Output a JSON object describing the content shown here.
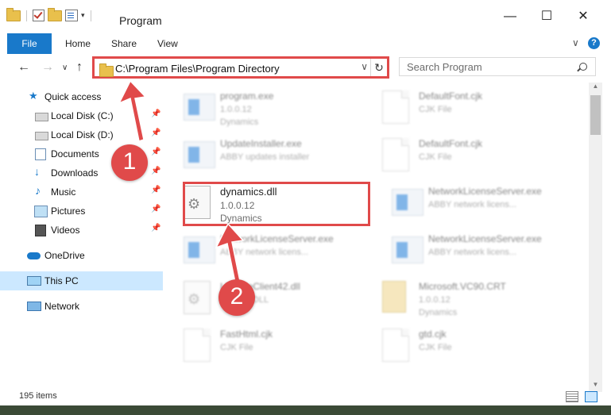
{
  "window": {
    "title": "Program"
  },
  "ribbon": {
    "tabs": [
      "File",
      "Home",
      "Share",
      "View"
    ],
    "help": "?"
  },
  "address": {
    "path": "C:\\Program Files\\Program Directory"
  },
  "search": {
    "placeholder": "Search Program"
  },
  "sidebar": {
    "items": [
      {
        "label": "Quick access",
        "icon": "star-icon",
        "pinned": false
      },
      {
        "label": "Local Disk (C:)",
        "icon": "drive-icon",
        "pinned": true
      },
      {
        "label": "Local Disk (D:)",
        "icon": "drive-icon",
        "pinned": true
      },
      {
        "label": "Documents",
        "icon": "documents-icon",
        "pinned": true
      },
      {
        "label": "Downloads",
        "icon": "download-icon",
        "pinned": true
      },
      {
        "label": "Music",
        "icon": "music-icon",
        "pinned": true
      },
      {
        "label": "Pictures",
        "icon": "pictures-icon",
        "pinned": true
      },
      {
        "label": "Videos",
        "icon": "videos-icon",
        "pinned": true
      },
      {
        "label": "OneDrive",
        "icon": "cloud-icon",
        "pinned": false
      },
      {
        "label": "This PC",
        "icon": "computer-icon",
        "pinned": false,
        "selected": true
      },
      {
        "label": "Network",
        "icon": "network-icon",
        "pinned": false
      }
    ]
  },
  "files": [
    {
      "name": "program.exe",
      "line1": "1.0.0.12",
      "line2": "Dynamics",
      "icon": "app-icon",
      "blurred": true
    },
    {
      "name": "DefaultFont.cjk",
      "line1": "CJK File",
      "line2": "",
      "icon": "document-icon",
      "blurred": true
    },
    {
      "name": "UpdateInstaller.exe",
      "line1": "ABBY updates installer",
      "line2": "",
      "icon": "app-icon",
      "blurred": true
    },
    {
      "name": "DefaultFont.cjk",
      "line1": "CJK File",
      "line2": "",
      "icon": "document-icon",
      "blurred": true
    },
    {
      "name": "dynamics.dll",
      "line1": "1.0.0.12",
      "line2": "Dynamics",
      "icon": "dll-icon",
      "blurred": false
    },
    {
      "name": "NetworkLicenseServer.exe",
      "line1": "ABBY network licens...",
      "line2": "",
      "icon": "app-icon",
      "blurred": true
    },
    {
      "name": "NetworkLicenseServer.exe",
      "line1": "ABBY network licens...",
      "line2": "",
      "icon": "app-icon",
      "blurred": true
    },
    {
      "name": "NetworkLicenseServer.exe",
      "line1": "ABBY network licens...",
      "line2": "",
      "icon": "app-icon",
      "blurred": true
    },
    {
      "name": "LicenseClient42.dll",
      "line1": "License DLL",
      "line2": "",
      "icon": "dll-icon",
      "blurred": true
    },
    {
      "name": "Microsoft.VC90.CRT",
      "line1": "1.0.0.12",
      "line2": "Dynamics",
      "icon": "folder-icon",
      "blurred": true
    },
    {
      "name": "FastHtml.cjk",
      "line1": "CJK File",
      "line2": "",
      "icon": "document-icon",
      "blurred": true
    },
    {
      "name": "gtd.cjk",
      "line1": "CJK File",
      "line2": "",
      "icon": "document-icon",
      "blurred": true
    }
  ],
  "status": {
    "count": "195 items"
  },
  "annotations": {
    "badge1": "1",
    "badge2": "2",
    "color": "#e04a4a"
  }
}
